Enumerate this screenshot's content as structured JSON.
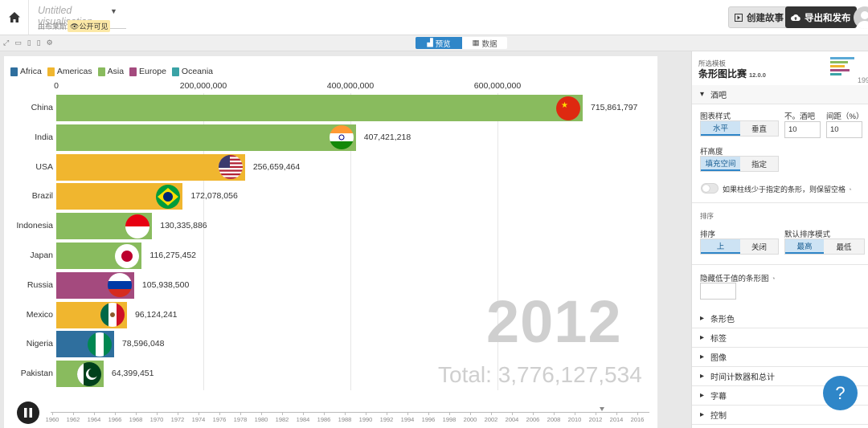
{
  "header": {
    "title_placeholder": "Untitled visualisation",
    "byline": "由布莱斯",
    "public_badge": "公开可见",
    "create_story": "创建故事",
    "export_publish": "导出和发布"
  },
  "view_tabs": {
    "preview": "预览",
    "data": "数据"
  },
  "legend": [
    {
      "label": "Africa",
      "color": "#2f6f9e"
    },
    {
      "label": "Americas",
      "color": "#f0b62f"
    },
    {
      "label": "Asia",
      "color": "#89bb5e"
    },
    {
      "label": "Europe",
      "color": "#a44a7e"
    },
    {
      "label": "Oceania",
      "color": "#3aa3a6"
    }
  ],
  "chart_data": {
    "type": "bar",
    "orientation": "horizontal",
    "xlim": [
      0,
      800000000
    ],
    "x_ticks": [
      "0",
      "200,000,000",
      "400,000,000",
      "600,000,000"
    ],
    "grid": true,
    "categories": [
      "China",
      "India",
      "USA",
      "Brazil",
      "Indonesia",
      "Japan",
      "Russia",
      "Mexico",
      "Nigeria",
      "Pakistan"
    ],
    "values": [
      715861797,
      407421218,
      256659464,
      172078056,
      130335886,
      116275452,
      105938500,
      96124241,
      78596048,
      64399451
    ],
    "value_labels": [
      "715,861,797",
      "407,421,218",
      "256,659,464",
      "172,078,056",
      "130,335,886",
      "116,275,452",
      "105,938,500",
      "96,124,241",
      "78,596,048",
      "64,399,451"
    ],
    "regions": [
      "Asia",
      "Asia",
      "Americas",
      "Americas",
      "Asia",
      "Asia",
      "Europe",
      "Americas",
      "Africa",
      "Asia"
    ],
    "year": "2012",
    "total_label": "Total: 3,776,127,534"
  },
  "timeline": {
    "years": [
      "1960",
      "1962",
      "1964",
      "1966",
      "1968",
      "1970",
      "1972",
      "1974",
      "1976",
      "1978",
      "1980",
      "1982",
      "1984",
      "1986",
      "1988",
      "1990",
      "1992",
      "1994",
      "1996",
      "1998",
      "2000",
      "2002",
      "2004",
      "2006",
      "2008",
      "2010",
      "2012",
      "2014",
      "2016"
    ],
    "current": 2012
  },
  "panel": {
    "template_label": "所选模板",
    "template_name": "条形图比赛",
    "template_version": "12.0.0",
    "thumb_year": "199",
    "bars_section": "酒吧",
    "chart_style_label": "图表样式",
    "style_horizontal": "水平",
    "style_vertical": "垂直",
    "no_bars_label": "不。酒吧",
    "no_bars_value": "10",
    "spacing_label": "间距（%）",
    "spacing_value": "10",
    "bar_height_label": "杆高度",
    "fill_space": "填充空间",
    "specify": "指定",
    "keep_space_toggle": "如果柱线少于指定的条形，则保留空格",
    "sort_section": "排序",
    "sort_label": "排序",
    "sort_on": "上",
    "sort_off": "关闭",
    "default_sort_label": "默认排序模式",
    "highest": "最高",
    "lowest": "最低",
    "hide_below_label": "隐藏低于值的条形图",
    "collapsed_sections": [
      "条形色",
      "标签",
      "图像",
      "时间计数器和总计",
      "字幕",
      "控制"
    ]
  },
  "help_label": "?"
}
